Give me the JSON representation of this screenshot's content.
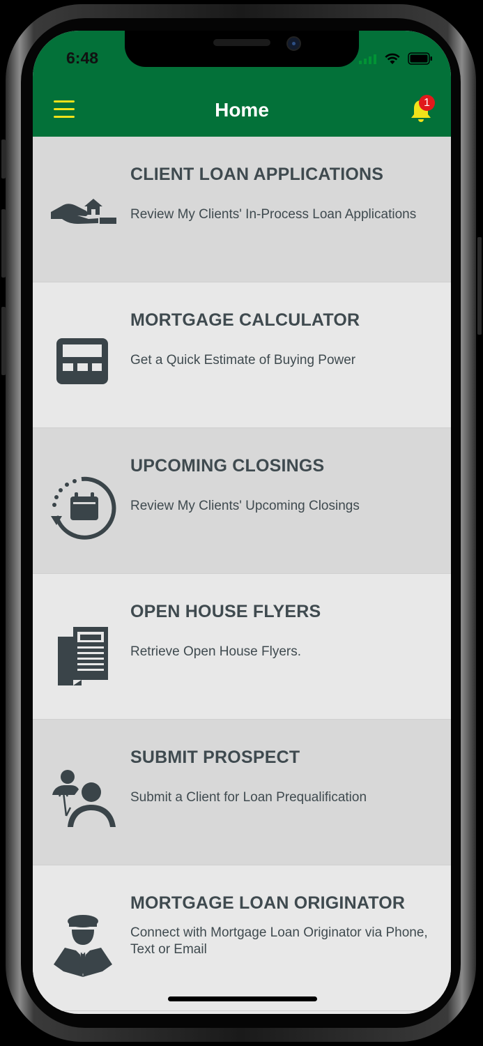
{
  "status_bar": {
    "time": "6:48"
  },
  "header": {
    "title": "Home",
    "notification_count": "1"
  },
  "menu_items": [
    {
      "title": "CLIENT LOAN APPLICATIONS",
      "description": "Review My Clients' In-Process Loan Applications",
      "icon": "hand-house-icon"
    },
    {
      "title": "MORTGAGE CALCULATOR",
      "description": "Get a Quick Estimate of Buying Power",
      "icon": "calculator-icon"
    },
    {
      "title": "UPCOMING CLOSINGS",
      "description": "Review My Clients' Upcoming Closings",
      "icon": "calendar-cycle-icon"
    },
    {
      "title": "OPEN HOUSE FLYERS",
      "description": "Retrieve Open House Flyers.",
      "icon": "flyers-icon"
    },
    {
      "title": "SUBMIT PROSPECT",
      "description": "Submit a Client for Loan Prequalification",
      "icon": "referral-people-icon"
    },
    {
      "title": "MORTGAGE LOAN ORIGINATOR",
      "description": "Connect with Mortgage Loan Originator via Phone, Text or Email",
      "icon": "officer-icon"
    }
  ],
  "colors": {
    "header_bg": "#037139",
    "accent_yellow": "#f1e21a",
    "badge_red": "#e1191b",
    "text_dark": "#3f4a4f"
  }
}
